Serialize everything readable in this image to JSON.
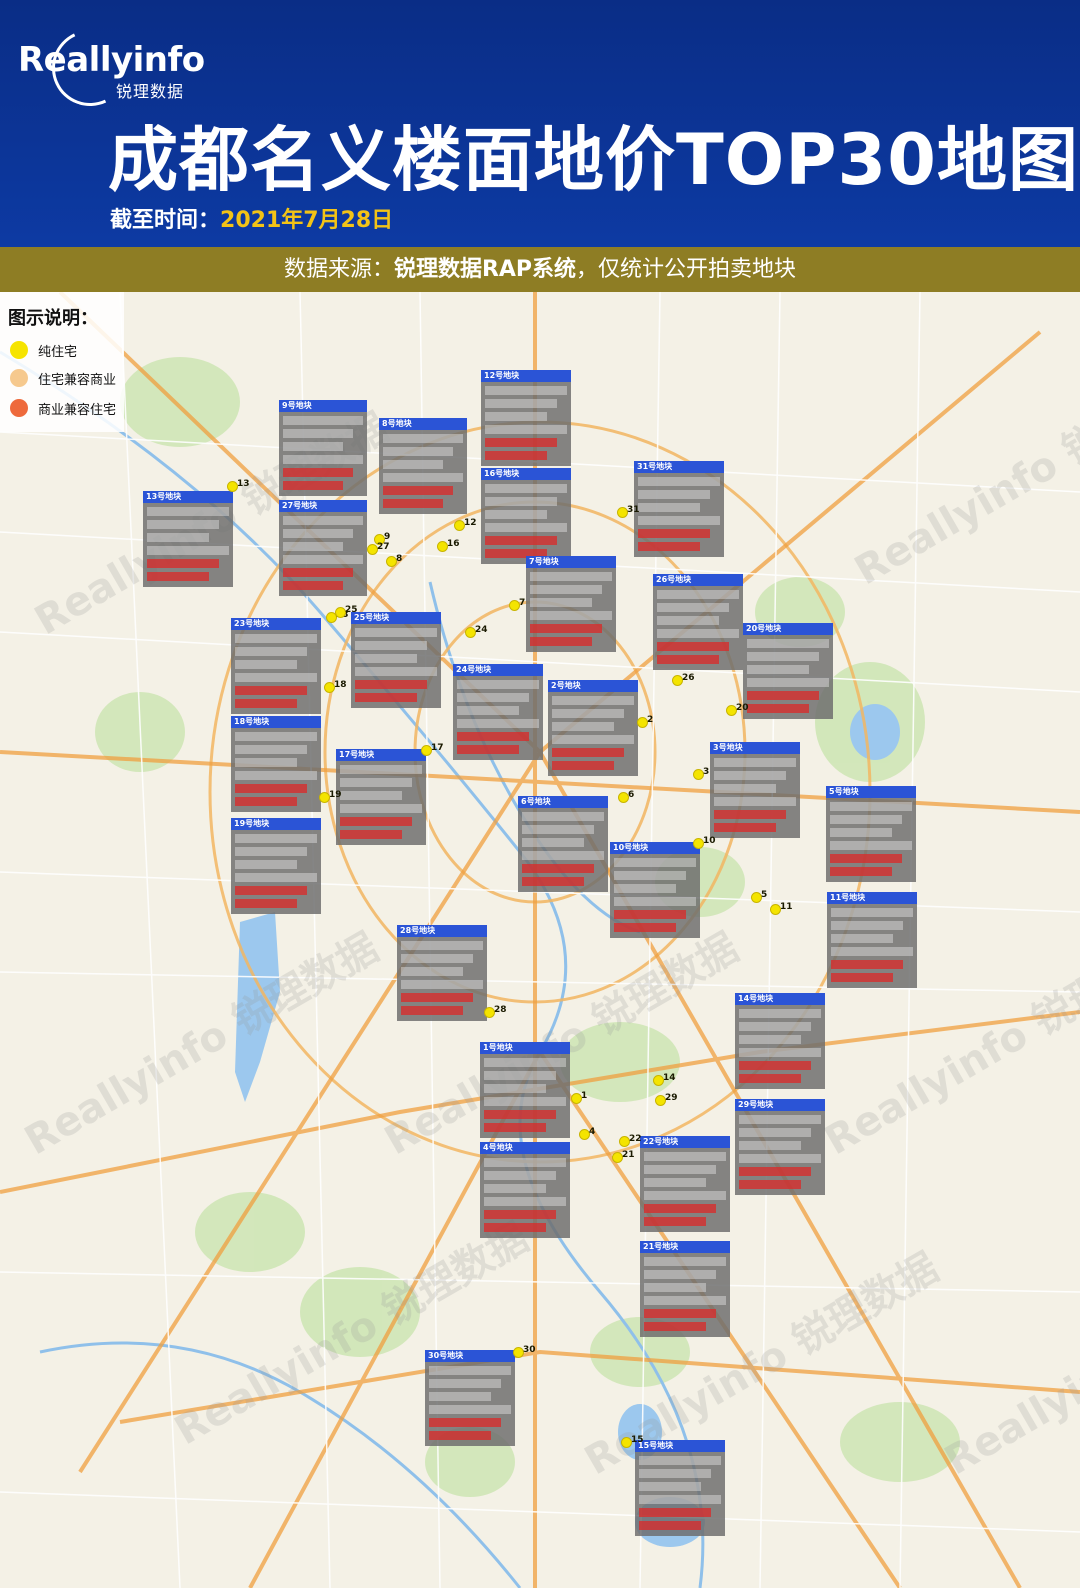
{
  "header": {
    "logo_text": "Reallyinfo",
    "logo_sub": "锐理数据",
    "title": "成都名义楼面地价TOP30地图",
    "date_label": "截至时间：",
    "date_value": "2021年7月28日"
  },
  "source_bar": {
    "prefix": "数据来源：",
    "system": "锐理数据RAP系统",
    "suffix": "，仅统计公开拍卖地块"
  },
  "legend": {
    "title": "图示说明：",
    "items": [
      {
        "label": "纯住宅",
        "color": "#f6e400"
      },
      {
        "label": "住宅兼容商业",
        "color": "#f6c98e"
      },
      {
        "label": "商业兼容住宅",
        "color": "#ee6a3c"
      }
    ]
  },
  "watermark": "Reallyinfo 锐理数据",
  "cards": [
    {
      "label": "13号地块"
    },
    {
      "label": "9号地块"
    },
    {
      "label": "8号地块"
    },
    {
      "label": "12号地块"
    },
    {
      "label": "16号地块"
    },
    {
      "label": "31号地块"
    },
    {
      "label": "27号地块"
    },
    {
      "label": "7号地块"
    },
    {
      "label": "26号地块"
    },
    {
      "label": "23号地块"
    },
    {
      "label": "25号地块"
    },
    {
      "label": "20号地块"
    },
    {
      "label": "24号地块"
    },
    {
      "label": "2号地块"
    },
    {
      "label": "18号地块"
    },
    {
      "label": "17号地块"
    },
    {
      "label": "3号地块"
    },
    {
      "label": "6号地块"
    },
    {
      "label": "5号地块"
    },
    {
      "label": "19号地块"
    },
    {
      "label": "10号地块"
    },
    {
      "label": "11号地块"
    },
    {
      "label": "28号地块"
    },
    {
      "label": "14号地块"
    },
    {
      "label": "1号地块"
    },
    {
      "label": "29号地块"
    },
    {
      "label": "4号地块"
    },
    {
      "label": "22号地块"
    },
    {
      "label": "21号地块"
    },
    {
      "label": "30号地块"
    },
    {
      "label": "15号地块"
    }
  ],
  "pins": [
    "13",
    "9",
    "27",
    "8",
    "12",
    "16",
    "31",
    "7",
    "23",
    "25",
    "24",
    "18",
    "26",
    "20",
    "2",
    "17",
    "19",
    "3",
    "6",
    "10",
    "5",
    "11",
    "28",
    "14",
    "1",
    "29",
    "4",
    "22",
    "21",
    "30",
    "15"
  ]
}
